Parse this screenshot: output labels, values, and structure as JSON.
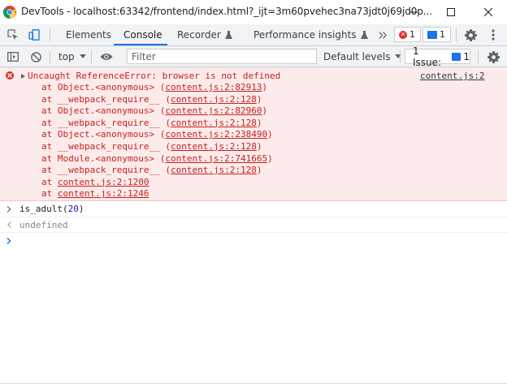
{
  "window": {
    "title": "DevTools - localhost:63342/frontend/index.html?_ijt=3m60pvehec3na73jdt0j69jd0p..."
  },
  "tabs": [
    {
      "label": "Elements"
    },
    {
      "label": "Console",
      "active": true
    },
    {
      "label": "Recorder"
    },
    {
      "label": "Performance insights"
    }
  ],
  "badges": {
    "errors": "1",
    "messages": "1"
  },
  "toolbar": {
    "context": "top",
    "filter_placeholder": "Filter",
    "levels": "Default levels",
    "issues_label": "1 Issue:",
    "issues_count": "1"
  },
  "error": {
    "message": "Uncaught ReferenceError: browser is not defined",
    "source": "content.js:2",
    "stack": [
      {
        "fn": "at Object.<anonymous> ",
        "loc": "content.js:2:82913"
      },
      {
        "fn": "at __webpack_require__ ",
        "loc": "content.js:2:128"
      },
      {
        "fn": "at Object.<anonymous> ",
        "loc": "content.js:2:82960"
      },
      {
        "fn": "at __webpack_require__ ",
        "loc": "content.js:2:128"
      },
      {
        "fn": "at Object.<anonymous> ",
        "loc": "content.js:2:238490"
      },
      {
        "fn": "at __webpack_require__ ",
        "loc": "content.js:2:128"
      },
      {
        "fn": "at Module.<anonymous> ",
        "loc": "content.js:2:741665"
      },
      {
        "fn": "at __webpack_require__ ",
        "loc": "content.js:2:128"
      },
      {
        "fn": "at ",
        "loc": "content.js:2:1200",
        "bare": true
      },
      {
        "fn": "at ",
        "loc": "content.js:2:1246",
        "bare": true
      }
    ]
  },
  "input": {
    "fn": "is_adult",
    "arg": "20"
  },
  "result": "undefined",
  "colors": {
    "error_red": "#d93025",
    "accent_blue": "#1a73e8",
    "error_bg": "#fcebeb"
  }
}
